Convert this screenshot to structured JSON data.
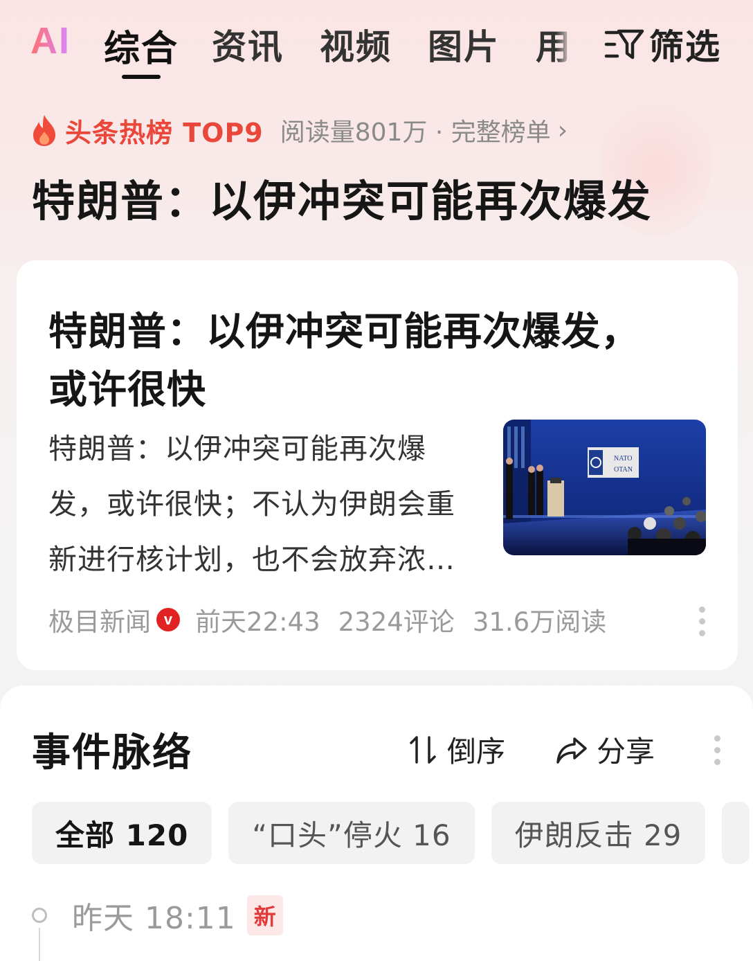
{
  "tabs": {
    "ai_label": "AI",
    "items": [
      "综合",
      "资讯",
      "视频",
      "图片",
      "用"
    ],
    "active_index": 0,
    "filter_label": "筛选"
  },
  "hot_list": {
    "icon": "flame-icon",
    "title": "头条热榜 TOP9",
    "meta": "阅读量801万 · 完整榜单"
  },
  "topic_title": "特朗普：以伊冲突可能再次爆发",
  "article": {
    "title_line1": "特朗普：以伊冲突可能再次爆发，",
    "title_line2": "或许很快",
    "summary": "特朗普：以伊冲突可能再次爆发，或许很快；不认为伊朗会重新进行核计划，也不会放弃浓缩铀……",
    "thumbnail_sign_line1": "NATO",
    "thumbnail_sign_line2": "OTAN",
    "source": "极目新闻",
    "verified_badge": "v",
    "time": "前天22:43",
    "comments": "2324评论",
    "reads": "31.6万阅读"
  },
  "timeline_panel": {
    "title": "事件脉络",
    "sort_label": "倒序",
    "share_label": "分享",
    "chips": [
      "全部 120",
      "“口头”停火 16",
      "伊朗反击 29"
    ],
    "active_chip": 0,
    "entry": {
      "time": "昨天 18:11",
      "badge": "新"
    }
  },
  "colors": {
    "accent_red": "#e9473a",
    "badge_red": "#e22222",
    "muted_gray": "#9a9a9a"
  }
}
